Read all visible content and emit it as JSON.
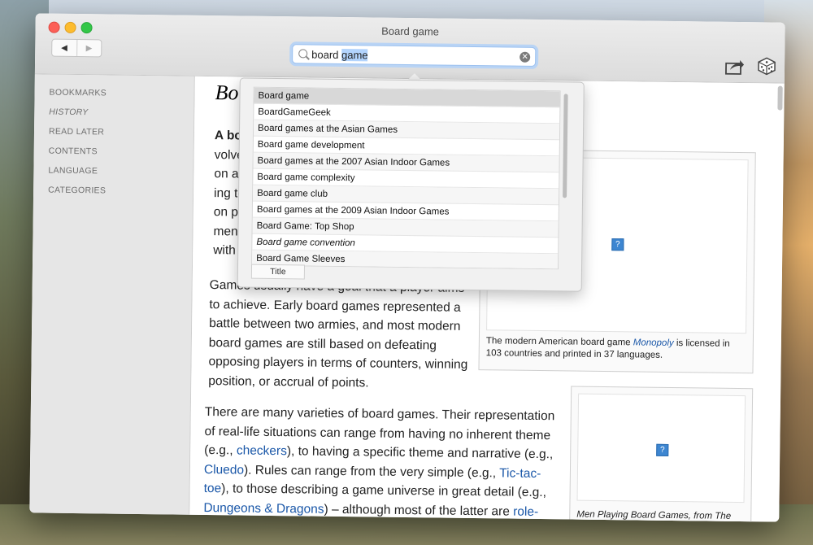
{
  "window": {
    "title": "Board game"
  },
  "nav": {
    "back_icon": "◀",
    "forward_icon": "▶"
  },
  "search": {
    "value_typed": "board ",
    "value_selected": "game",
    "clear_icon": "✕"
  },
  "toolbar": {
    "share_icon": "share-icon",
    "random_icon": "dice-icon"
  },
  "sidebar": {
    "items": [
      "BOOKMARKS",
      "HISTORY",
      "READ LATER",
      "CONTENTS",
      "LANGUAGE",
      "CATEGORIES"
    ]
  },
  "article": {
    "title": "Bo",
    "intro_lines": [
      "A bo",
      "volve",
      "on a",
      "ing to",
      "on pr",
      "ment",
      "with"
    ],
    "para2": "Games usually have a goal that a player aims to achieve. Early board games represented a battle between two armies, and most modern board games are still based on defeating opposing players in terms of counters, winning position, or accrual of points.",
    "para3_before_checkers": "There are many varieties of board games. Their representation of real-life situations can range from having no inherent theme (e.g., ",
    "link_checkers": "checkers",
    "para3_mid1": "), to having a specific theme and narrative (e.g., ",
    "link_cluedo": "Cluedo",
    "para3_mid2": "). Rules can range from the very simple (e.g., ",
    "link_tictactoe": "Tic-tac-toe",
    "para3_mid3": "), to those describing a game universe in great detail (e.g., ",
    "link_dnd": "Dungeons & Dragons",
    "para3_end": ") – although most of the latter are ",
    "link_role": "role-"
  },
  "figure1": {
    "icon": "?",
    "caption_before": "The modern American board game ",
    "caption_link": "Monopoly",
    "caption_after": " is licensed in 103 countries and printed in 37 languages."
  },
  "figure2": {
    "icon": "?",
    "caption": "Men Playing Board Games, from The"
  },
  "dropdown": {
    "items": [
      "Board game",
      "BoardGameGeek",
      "Board games at the Asian Games",
      "Board game development",
      "Board games at the 2007 Asian Indoor Games",
      "Board game complexity",
      "Board game club",
      "Board games at the 2009 Asian Indoor Games",
      "Board Game: Top Shop",
      "Board game convention",
      "Board Game Sleeves"
    ],
    "column_header": "Title"
  }
}
